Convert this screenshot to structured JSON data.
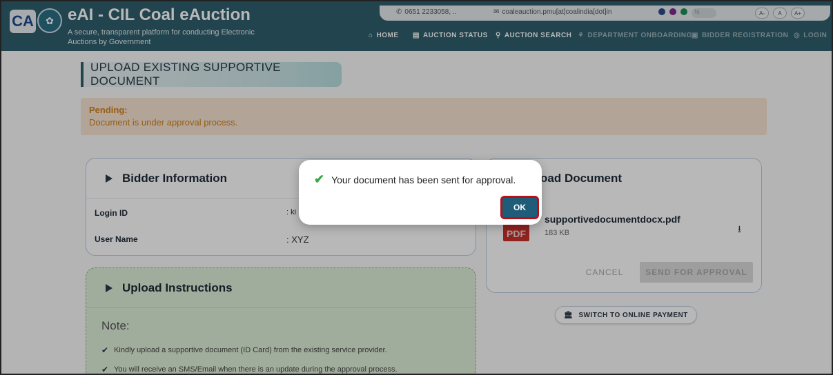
{
  "header": {
    "logo_text": "CA",
    "title": "eAI - CIL Coal eAuction",
    "subtitle": "A secure, transparent platform for conducting Electronic Auctions by Government",
    "contact": {
      "phone": "0651 2233058, ..",
      "email": "coaleauction.pmu[at]coalindia[dot]in"
    },
    "font_controls": [
      "A-",
      "A",
      "A+"
    ],
    "nav": [
      {
        "label": "HOME",
        "icon": "home-icon"
      },
      {
        "label": "AUCTION STATUS",
        "icon": "chart-icon"
      },
      {
        "label": "AUCTION SEARCH",
        "icon": "search-icon"
      },
      {
        "label": "DEPARTMENT ONBOARDING",
        "icon": "handshake-icon"
      },
      {
        "label": "BIDDER REGISTRATION",
        "icon": "id-card-icon"
      },
      {
        "label": "LOGIN",
        "icon": "user-icon"
      }
    ]
  },
  "page": {
    "title": "UPLOAD EXISTING SUPPORTIVE DOCUMENT",
    "pending": {
      "heading": "Pending:",
      "text": "Document is under approval process."
    }
  },
  "bidder_info": {
    "heading": "Bidder Information",
    "rows": [
      {
        "label": "Login ID",
        "value": ": ki"
      },
      {
        "label": "User Name",
        "value": ":  XYZ"
      }
    ]
  },
  "upload_document": {
    "heading": "oad Document",
    "file_name": "supportivedocumentdocx.pdf",
    "file_size": "183 KB",
    "cancel_label": "CANCEL",
    "send_label": "SEND FOR APPROVAL"
  },
  "switch_payment_label": "SWITCH TO ONLINE PAYMENT",
  "instructions": {
    "heading": "Upload Instructions",
    "note": "Note:",
    "items": [
      "Kindly upload a supportive document (ID Card) from the existing service provider.",
      "You will receive an SMS/Email when there is an update during the approval process."
    ]
  },
  "dialog": {
    "message": "Your document has been sent for approval.",
    "ok_label": "OK"
  },
  "colors": {
    "header_bg": "#2f5f6c",
    "pending_text": "#d2811c",
    "ok_button": "#1e5c78",
    "highlight_border": "#b1121c",
    "success_check": "#3fa54a"
  }
}
